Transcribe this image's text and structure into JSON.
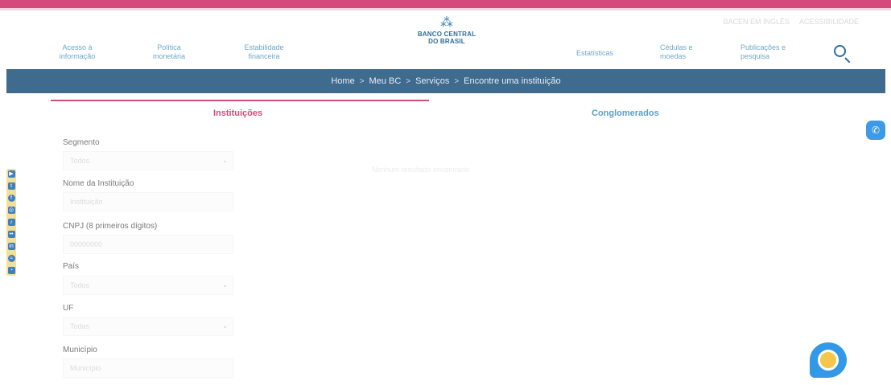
{
  "header": {
    "util_links": [
      "BACEN EM INGLÊS",
      "ACESSIBILIDADE"
    ],
    "nav_left": [
      {
        "line1": "Acesso à",
        "line2": "informação"
      },
      {
        "line1": "Política",
        "line2": "monetária"
      },
      {
        "line1": "Estabilidade",
        "line2": "financeira"
      }
    ],
    "nav_right": [
      {
        "line1": "Estatísticas",
        "line2": ""
      },
      {
        "line1": "Cédulas e",
        "line2": "moedas"
      },
      {
        "line1": "Publicações e",
        "line2": "pesquisa"
      }
    ],
    "logo": {
      "mark": "⁂",
      "line1": "BANCO CENTRAL",
      "line2": "DO BRASIL"
    },
    "search_icon": "search-icon"
  },
  "breadcrumb": [
    "Home",
    "Meu BC",
    "Serviços",
    "Encontre uma instituição"
  ],
  "breadcrumb_separator": ">",
  "tabs": {
    "active": "Instituições",
    "inactive": "Conglomerados"
  },
  "form": {
    "segmento": {
      "label": "Segmento",
      "value": "Todos"
    },
    "nome": {
      "label": "Nome da Instituição",
      "placeholder": "Instituição"
    },
    "cnpj": {
      "label": "CNPJ (8 primeiros dígitos)",
      "placeholder": "00000000"
    },
    "pais": {
      "label": "País",
      "value": "Todos"
    },
    "uf": {
      "label": "UF",
      "value": "Todas"
    },
    "municipio": {
      "label": "Município",
      "placeholder": "Município"
    }
  },
  "ghost_text": "Nenhum resultado encontrado",
  "social_icons": [
    "youtube-icon",
    "twitter-icon",
    "facebook-icon",
    "instagram-icon",
    "tiktok-icon",
    "flickr-icon",
    "linkedin-icon",
    "spotify-icon",
    "rss-icon"
  ],
  "colors": {
    "accent": "#d44a7a",
    "brand": "#2d6e9c",
    "breadcrumb_bg": "#3f6b8f",
    "chat": "#3399e6"
  }
}
